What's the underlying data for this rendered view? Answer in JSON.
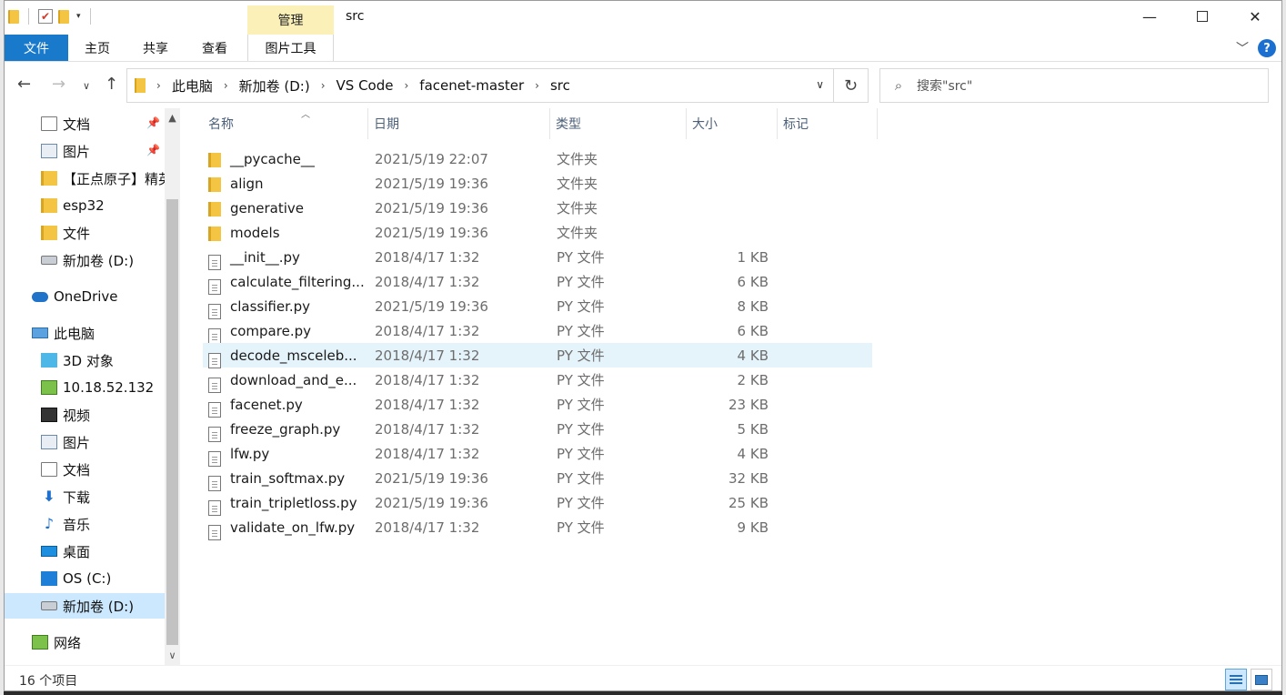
{
  "window": {
    "title": "src",
    "context_tab": "管理",
    "minimize": "—",
    "close": "✕"
  },
  "ribbon": {
    "tabs": [
      "文件",
      "主页",
      "共享",
      "查看",
      "图片工具"
    ],
    "collapse": "﹀",
    "help": "?"
  },
  "address": {
    "crumbs": [
      "此电脑",
      "新加卷 (D:)",
      "VS Code",
      "facenet-master",
      "src"
    ],
    "search_placeholder": "搜索\"src\""
  },
  "sidebar": {
    "items": [
      {
        "label": "文档",
        "icon": "document-icon",
        "pinned": true
      },
      {
        "label": "图片",
        "icon": "pictures-icon",
        "pinned": true
      },
      {
        "label": "【正点原子】精英",
        "icon": "folder-icon",
        "pinned": false
      },
      {
        "label": "esp32",
        "icon": "folder-icon",
        "pinned": false
      },
      {
        "label": "文件",
        "icon": "folder-icon",
        "pinned": false
      },
      {
        "label": "新加卷 (D:)",
        "icon": "drive-icon",
        "pinned": false
      },
      {
        "label": "OneDrive",
        "icon": "onedrive-cloud-icon",
        "pinned": false
      },
      {
        "label": "此电脑",
        "icon": "this-pc-icon",
        "pinned": false
      },
      {
        "label": "3D 对象",
        "icon": "3d-objects-icon",
        "pinned": false
      },
      {
        "label": "10.18.52.132",
        "icon": "network-drive-icon",
        "pinned": false
      },
      {
        "label": "视频",
        "icon": "videos-icon",
        "pinned": false
      },
      {
        "label": "图片",
        "icon": "pictures-icon",
        "pinned": false
      },
      {
        "label": "文档",
        "icon": "document-icon",
        "pinned": false
      },
      {
        "label": "下载",
        "icon": "downloads-icon",
        "pinned": false
      },
      {
        "label": "音乐",
        "icon": "music-icon",
        "pinned": false
      },
      {
        "label": "桌面",
        "icon": "desktop-icon",
        "pinned": false
      },
      {
        "label": "OS (C:)",
        "icon": "windows-drive-icon",
        "pinned": false
      },
      {
        "label": "新加卷 (D:)",
        "icon": "drive-icon",
        "pinned": false,
        "selected": true
      },
      {
        "label": "网络",
        "icon": "network-icon",
        "pinned": false
      }
    ]
  },
  "columns": [
    "名称",
    "日期",
    "类型",
    "大小",
    "标记"
  ],
  "files": [
    {
      "name": "__pycache__",
      "date": "2021/5/19 22:07",
      "type": "文件夹",
      "size": "",
      "kind": "folder"
    },
    {
      "name": "align",
      "date": "2021/5/19 19:36",
      "type": "文件夹",
      "size": "",
      "kind": "folder"
    },
    {
      "name": "generative",
      "date": "2021/5/19 19:36",
      "type": "文件夹",
      "size": "",
      "kind": "folder"
    },
    {
      "name": "models",
      "date": "2021/5/19 19:36",
      "type": "文件夹",
      "size": "",
      "kind": "folder"
    },
    {
      "name": "__init__.py",
      "date": "2018/4/17 1:32",
      "type": "PY 文件",
      "size": "1 KB",
      "kind": "file"
    },
    {
      "name": "calculate_filtering...",
      "date": "2018/4/17 1:32",
      "type": "PY 文件",
      "size": "6 KB",
      "kind": "file"
    },
    {
      "name": "classifier.py",
      "date": "2021/5/19 19:36",
      "type": "PY 文件",
      "size": "8 KB",
      "kind": "file"
    },
    {
      "name": "compare.py",
      "date": "2018/4/17 1:32",
      "type": "PY 文件",
      "size": "6 KB",
      "kind": "file"
    },
    {
      "name": "decode_msceleb...",
      "date": "2018/4/17 1:32",
      "type": "PY 文件",
      "size": "4 KB",
      "kind": "file",
      "hovered": true
    },
    {
      "name": "download_and_e...",
      "date": "2018/4/17 1:32",
      "type": "PY 文件",
      "size": "2 KB",
      "kind": "file"
    },
    {
      "name": "facenet.py",
      "date": "2018/4/17 1:32",
      "type": "PY 文件",
      "size": "23 KB",
      "kind": "file"
    },
    {
      "name": "freeze_graph.py",
      "date": "2018/4/17 1:32",
      "type": "PY 文件",
      "size": "5 KB",
      "kind": "file"
    },
    {
      "name": "lfw.py",
      "date": "2018/4/17 1:32",
      "type": "PY 文件",
      "size": "4 KB",
      "kind": "file"
    },
    {
      "name": "train_softmax.py",
      "date": "2021/5/19 19:36",
      "type": "PY 文件",
      "size": "32 KB",
      "kind": "file"
    },
    {
      "name": "train_tripletloss.py",
      "date": "2021/5/19 19:36",
      "type": "PY 文件",
      "size": "25 KB",
      "kind": "file"
    },
    {
      "name": "validate_on_lfw.py",
      "date": "2018/4/17 1:32",
      "type": "PY 文件",
      "size": "9 KB",
      "kind": "file"
    }
  ],
  "status": {
    "item_count": "16 个项目"
  }
}
